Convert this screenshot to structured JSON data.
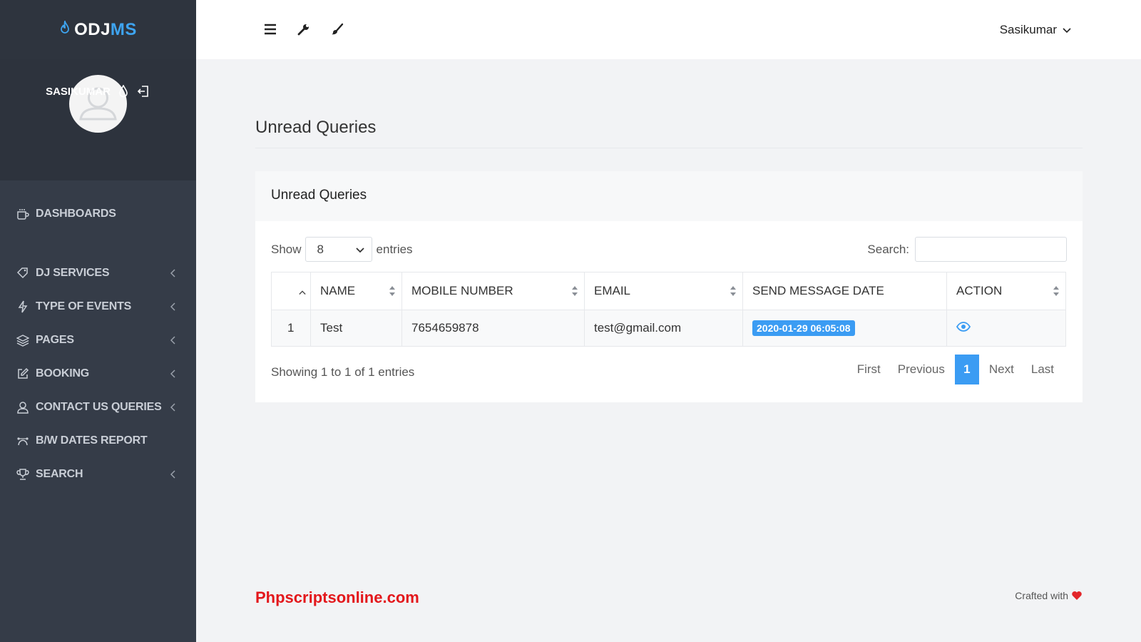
{
  "brand": {
    "part1": "ODJ",
    "part2": "MS"
  },
  "user": {
    "name": "SASIKUMAR"
  },
  "sidebar": {
    "items": [
      {
        "label": "DASHBOARDS",
        "icon": "coffee-icon",
        "has_chevron": false
      },
      {
        "label": "DJ SERVICES",
        "icon": "tag-icon",
        "has_chevron": true
      },
      {
        "label": "TYPE OF EVENTS",
        "icon": "bolt-icon",
        "has_chevron": true
      },
      {
        "label": "PAGES",
        "icon": "layers-icon",
        "has_chevron": true
      },
      {
        "label": "BOOKING",
        "icon": "edit-icon",
        "has_chevron": true
      },
      {
        "label": "CONTACT US QUERIES",
        "icon": "user-icon",
        "has_chevron": true
      },
      {
        "label": "B/W DATES REPORT",
        "icon": "bezier-icon",
        "has_chevron": false
      },
      {
        "label": "SEARCH",
        "icon": "trophy-icon",
        "has_chevron": true
      }
    ]
  },
  "topbar": {
    "user_dropdown": "Sasikumar"
  },
  "page": {
    "title": "Unread Queries"
  },
  "card": {
    "title": "Unread Queries",
    "show_label": "Show",
    "entries_value": "8",
    "entries_label": "entries",
    "search_label": "Search:",
    "search_value": ""
  },
  "table": {
    "columns": [
      "",
      "NAME",
      "MOBILE NUMBER",
      "EMAIL",
      "SEND MESSAGE DATE",
      "ACTION"
    ],
    "rows": [
      {
        "index": "1",
        "name": "Test",
        "mobile": "7654659878",
        "email": "test@gmail.com",
        "date": "2020-01-29 06:05:08"
      }
    ]
  },
  "info": "Showing 1 to 1 of 1 entries",
  "pagination": {
    "first": "First",
    "previous": "Previous",
    "current": "1",
    "next": "Next",
    "last": "Last"
  },
  "footer": {
    "left": "Phpscriptsonline.com",
    "right": "Crafted with"
  },
  "colors": {
    "accent": "#3b9cf3",
    "sidebar": "#353c48",
    "footer_brand": "#e3171b"
  }
}
